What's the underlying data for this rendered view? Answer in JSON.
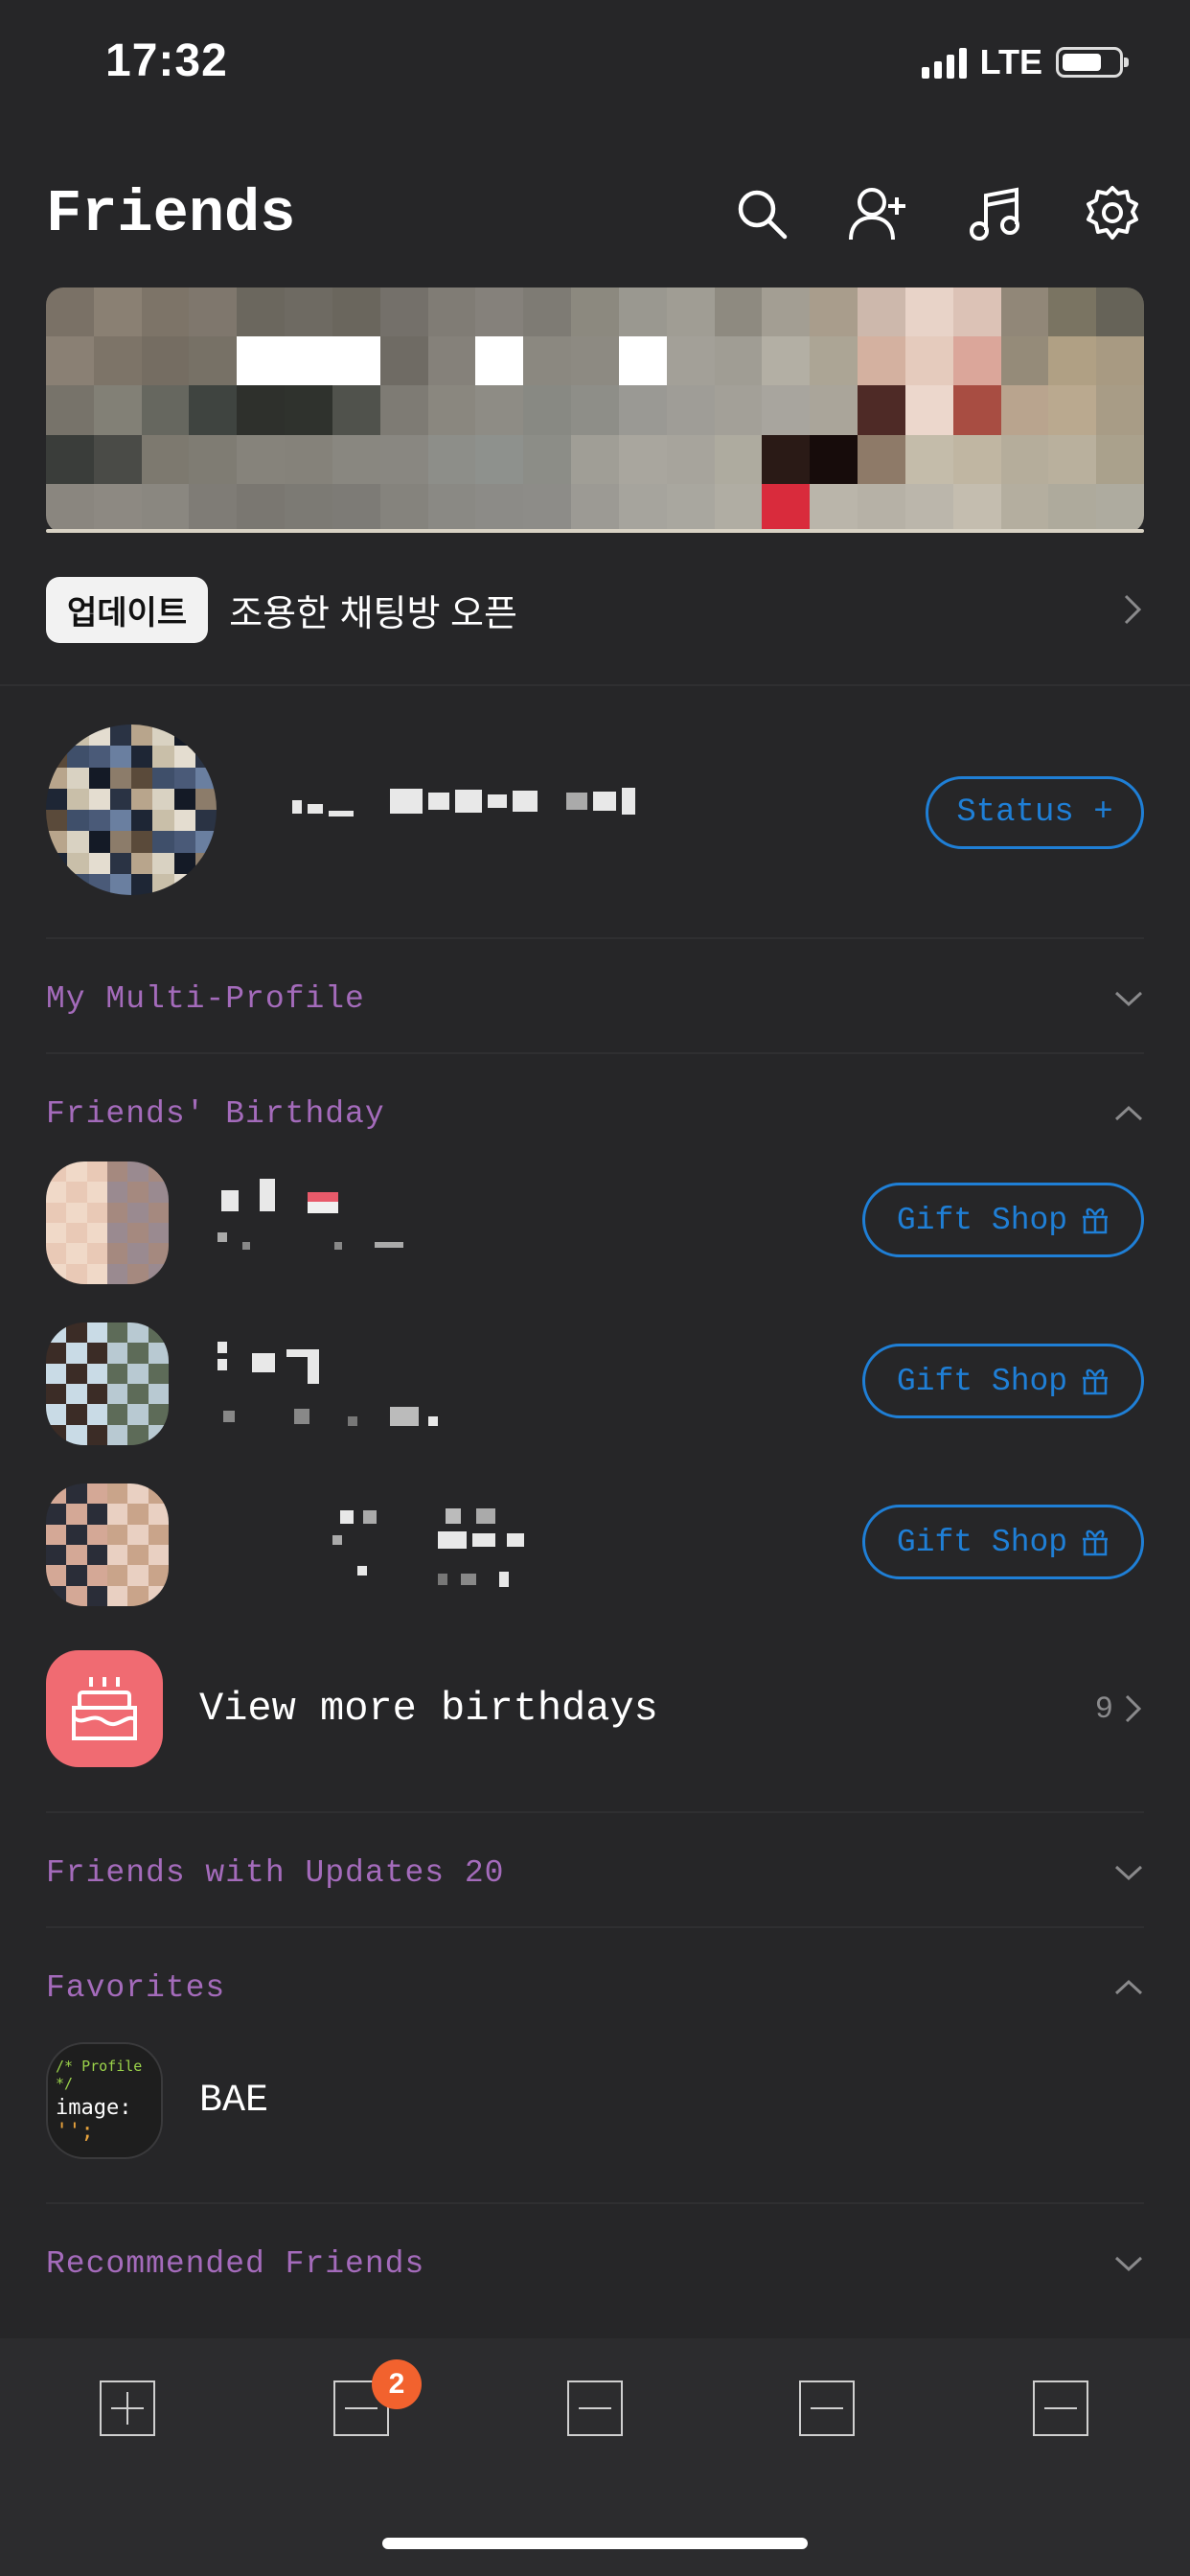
{
  "status_bar": {
    "time": "17:32",
    "network": "LTE"
  },
  "header": {
    "title": "Friends",
    "icons": [
      "search-icon",
      "add-friend-icon",
      "music-icon",
      "settings-icon"
    ]
  },
  "update_banner": {
    "badge": "업데이트",
    "text": "조용한 채팅방 오픈"
  },
  "my_profile": {
    "status_button": "Status +"
  },
  "sections": {
    "multi_profile": "My Multi-Profile",
    "birthday": "Friends' Birthday",
    "updates": "Friends with Updates 20",
    "favorites": "Favorites",
    "recommended": "Recommended Friends"
  },
  "birthday_friends": [
    {
      "gift_label": "Gift Shop"
    },
    {
      "gift_label": "Gift Shop"
    },
    {
      "gift_label": "Gift Shop"
    }
  ],
  "more_birthdays": {
    "label": "View more birthdays",
    "count": "9"
  },
  "favorites": [
    {
      "name": "BAE",
      "avatar_line1": "/* Profile */",
      "avatar_line2_key": "image:",
      "avatar_line2_val": " '';"
    }
  ],
  "tab_bar": {
    "badge_count": "2"
  },
  "colors": {
    "accent_blue": "#1f7fd6",
    "section_purple": "#a46bbb",
    "cake_pink": "#f06b72",
    "badge_orange": "#f2622e"
  }
}
